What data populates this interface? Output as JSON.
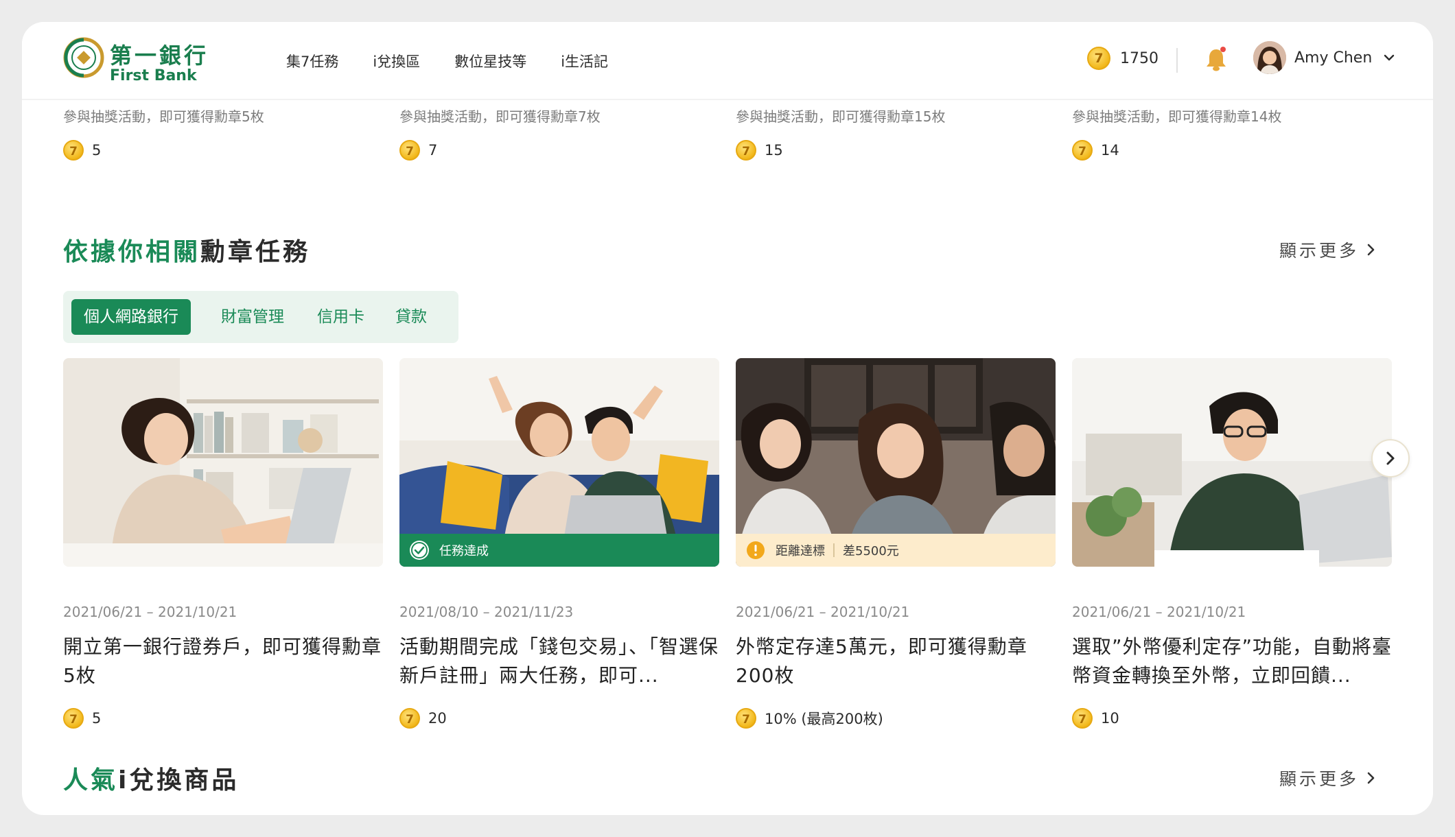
{
  "brand": {
    "name_cn": "第一銀行",
    "name_en": "First Bank"
  },
  "nav": {
    "items": [
      "集7任務",
      "i兌換區",
      "數位星技等",
      "i生活記"
    ]
  },
  "user": {
    "points": "1750",
    "name": "Amy Chen"
  },
  "coin_label": "7",
  "prev_row": [
    {
      "desc": "參與抽獎活動，即可獲得勳章5枚",
      "reward": "5"
    },
    {
      "desc": "參與抽獎活動，即可獲得勳章7枚",
      "reward": "7"
    },
    {
      "desc": "參與抽獎活動，即可獲得勳章15枚",
      "reward": "15"
    },
    {
      "desc": "參與抽獎活動，即可獲得勳章14枚",
      "reward": "14"
    }
  ],
  "section1": {
    "title_hl": "依據你相關",
    "title_rest": "勳章任務",
    "show_more": "顯示更多"
  },
  "tabs": [
    "個人網路銀行",
    "財富管理",
    "信用卡",
    "貸款"
  ],
  "cards": [
    {
      "date": "2021/06/21 – 2021/10/21",
      "title": "開立第一銀行證券戶，即可獲得勳章5枚",
      "reward": "5"
    },
    {
      "date": "2021/08/10 – 2021/11/23",
      "title": "活動期間完成「錢包交易」、「智選保新戶註冊」兩大任務，即可...",
      "reward": "20",
      "status": "任務達成"
    },
    {
      "date": "2021/06/21 – 2021/10/21",
      "title": "外幣定存達5萬元，即可獲得勳章200枚",
      "reward": "10% (最高200枚)",
      "status_label": "距離達標",
      "status_value": "差5500元"
    },
    {
      "date": "2021/06/21 – 2021/10/21",
      "title": "選取”外幣優利定存”功能，自動將臺幣資金轉換至外幣，立即回饋...",
      "reward": "10"
    }
  ],
  "section2": {
    "title_hl": "人氣",
    "title_rest": "i兌換商品",
    "show_more": "顯示更多"
  },
  "colors": {
    "brand_green": "#1a8a57",
    "coin_gold": "#f2b81b",
    "warn_bg": "#fdeccc"
  }
}
